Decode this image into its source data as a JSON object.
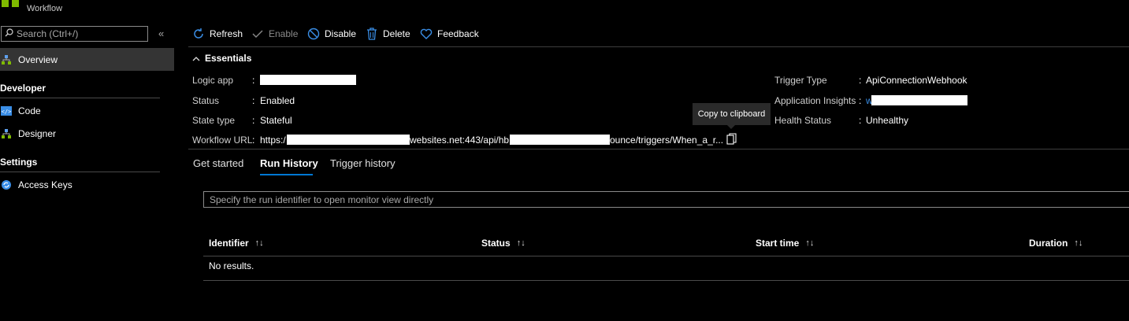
{
  "header": {
    "subtitle": "Workflow"
  },
  "sidebar": {
    "search_placeholder": "Search (Ctrl+/)",
    "collapse_icon": "«",
    "items": [
      {
        "label": "Overview",
        "icon": "overview-icon"
      },
      {
        "label": "Code",
        "icon": "code-icon"
      },
      {
        "label": "Designer",
        "icon": "designer-icon"
      },
      {
        "label": "Access Keys",
        "icon": "keys-icon"
      }
    ],
    "sections": [
      "Developer",
      "Settings"
    ]
  },
  "toolbar": {
    "refresh": "Refresh",
    "enable": "Enable",
    "disable": "Disable",
    "delete": "Delete",
    "feedback": "Feedback"
  },
  "essentials": {
    "title": "Essentials",
    "logic_app_label": "Logic app",
    "status_label": "Status",
    "status_value": "Enabled",
    "state_type_label": "State type",
    "state_type_value": "Stateful",
    "workflow_url_label": "Workflow URL",
    "url_part1": "https:/",
    "url_part2": "websites.net:443/api/hb",
    "url_part3": "ounce/triggers/When_a_r...",
    "trigger_type_label": "Trigger Type",
    "trigger_type_value": "ApiConnectionWebhook",
    "app_insights_label": "Application Insights",
    "app_insights_value": "w",
    "health_status_label": "Health Status",
    "health_status_value": "Unhealthy",
    "separator": ":",
    "tooltip": "Copy to clipboard"
  },
  "tabs": [
    "Get started",
    "Run History",
    "Trigger history"
  ],
  "run_history": {
    "search_placeholder": "Specify the run identifier to open monitor view directly",
    "columns": [
      "Identifier",
      "Status",
      "Start time",
      "Duration"
    ],
    "sort_glyph": "↑↓",
    "empty": "No results."
  },
  "colors": {
    "accent": "#0078d4",
    "logo": "#7fba00",
    "background": "#000000",
    "selected": "#343434"
  }
}
